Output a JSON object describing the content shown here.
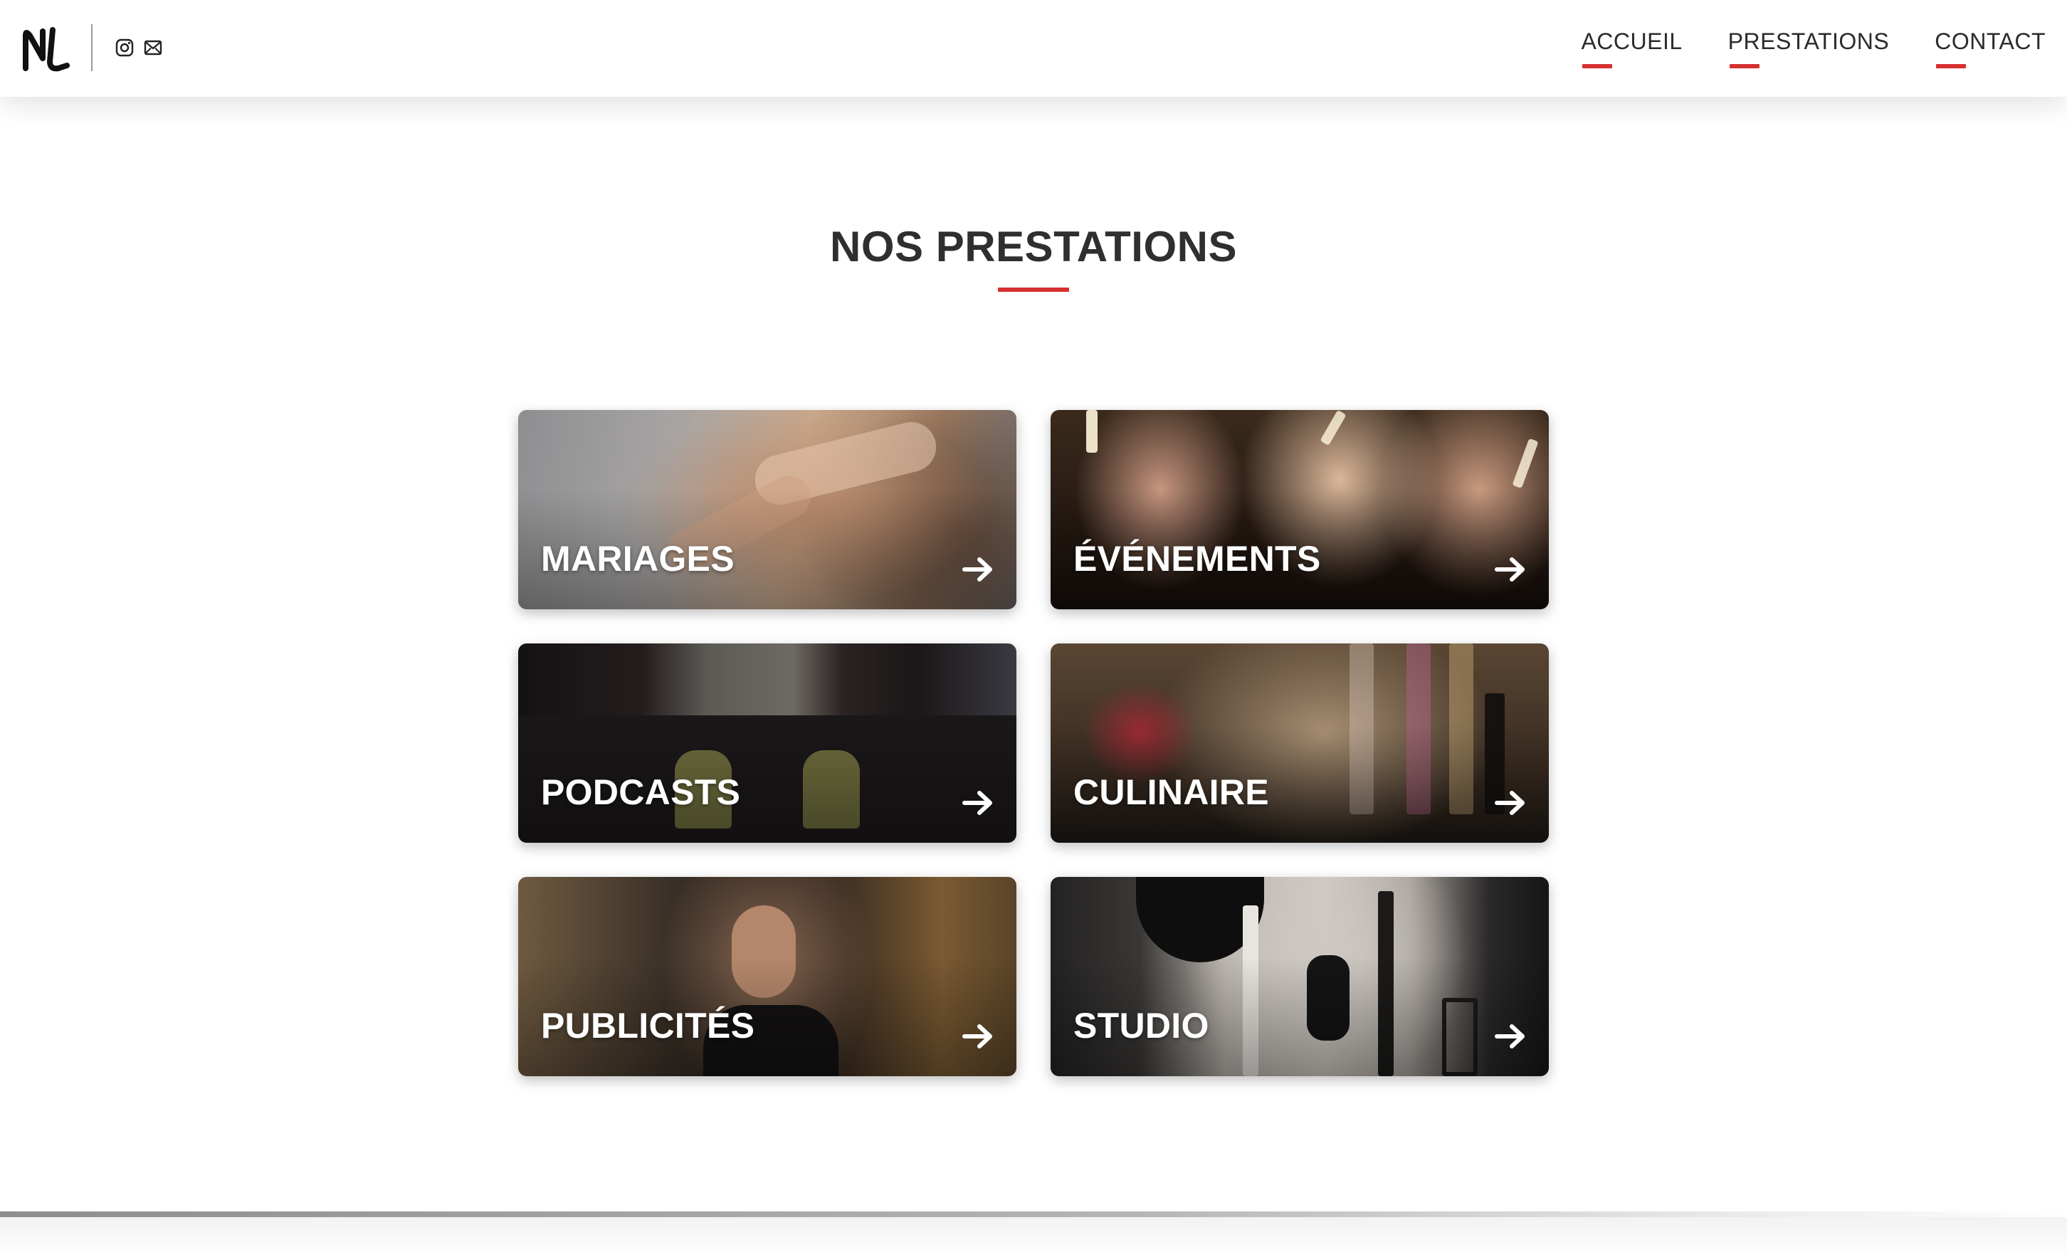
{
  "header": {
    "logo_icon": "nl-monogram-logo",
    "social": [
      {
        "icon": "instagram-icon"
      },
      {
        "icon": "mail-icon"
      }
    ],
    "nav": [
      {
        "label": "ACCUEIL"
      },
      {
        "label": "PRESTATIONS"
      },
      {
        "label": "CONTACT"
      }
    ],
    "accent_color": "#d63031"
  },
  "main": {
    "title": "NOS PRESTATIONS",
    "cards": [
      {
        "label": "MARIAGES",
        "arrow_icon": "arrow-right-icon"
      },
      {
        "label": "ÉVÉNEMENTS",
        "arrow_icon": "arrow-right-icon"
      },
      {
        "label": "PODCASTS",
        "arrow_icon": "arrow-right-icon"
      },
      {
        "label": "CULINAIRE",
        "arrow_icon": "arrow-right-icon"
      },
      {
        "label": "PUBLICITÉS",
        "arrow_icon": "arrow-right-icon"
      },
      {
        "label": "STUDIO",
        "arrow_icon": "arrow-right-icon"
      }
    ]
  }
}
